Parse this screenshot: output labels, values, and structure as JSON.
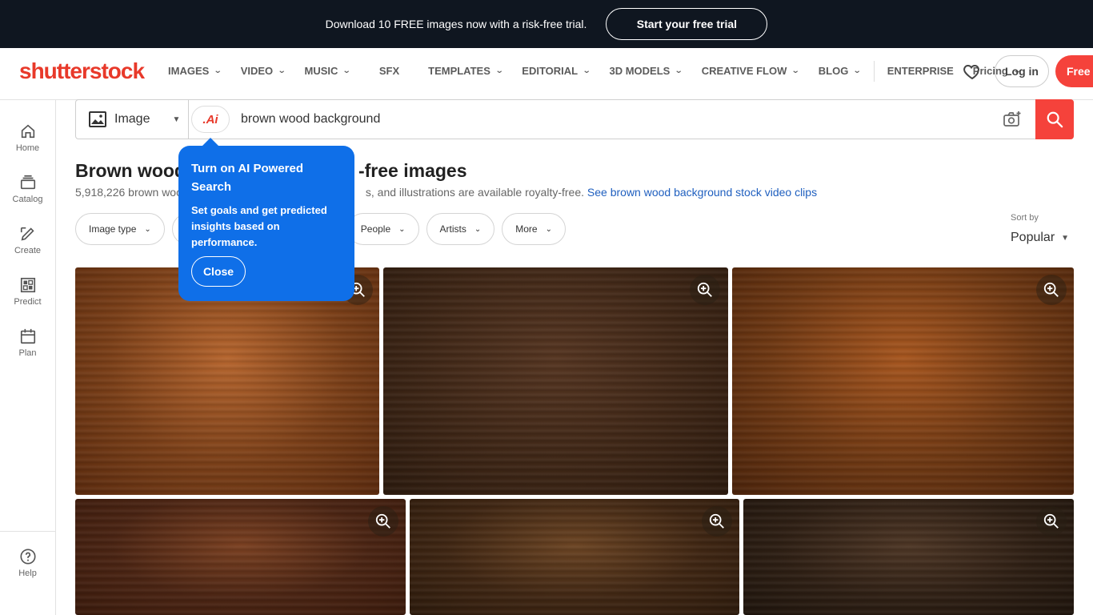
{
  "promo": {
    "text": "Download 10 FREE images now with a risk-free trial.",
    "button": "Start your free trial"
  },
  "header": {
    "logo": "shutterstock",
    "nav": [
      "IMAGES",
      "VIDEO",
      "MUSIC",
      "SFX",
      "TEMPLATES",
      "EDITORIAL",
      "3D MODELS",
      "CREATIVE FLOW",
      "BLOG"
    ],
    "enterprise": "ENTERPRISE",
    "pricing": "Pricing",
    "login": "Log in",
    "free_button": "Free t"
  },
  "rail": {
    "items": [
      "Home",
      "Catalog",
      "Create",
      "Predict",
      "Plan"
    ],
    "help": "Help"
  },
  "search": {
    "type": "Image",
    "ai_label": ".Ai",
    "query": "brown wood background"
  },
  "results": {
    "title_start": "Brown wood",
    "title_end": "-free images",
    "count_start": "5,918,226 brown woo",
    "count_end": "s, and illustrations are available royalty-free.",
    "video_link": "See brown wood background stock video clips"
  },
  "filters": {
    "chips": [
      "Image type",
      "People",
      "Artists",
      "More"
    ],
    "sort_label": "Sort by",
    "sort_value": "Popular"
  },
  "popover": {
    "title": "Turn on AI Powered Search",
    "body": "Set goals and get predicted insights based on performance.",
    "close": "Close"
  },
  "images": [
    {
      "colors": [
        "#7a3f18",
        "#b5652e",
        "#5a2a0e"
      ]
    },
    {
      "colors": [
        "#3e2616",
        "#553521",
        "#2b1a0e"
      ]
    },
    {
      "colors": [
        "#6e3813",
        "#a6561f",
        "#4a230b"
      ]
    },
    {
      "colors": [
        "#4a2413",
        "#7a4021",
        "#3a1a0c"
      ]
    },
    {
      "colors": [
        "#3f2613",
        "#6b4423",
        "#2c1a0c"
      ]
    },
    {
      "colors": [
        "#2e1f14",
        "#4d3625",
        "#1e140c"
      ]
    }
  ]
}
